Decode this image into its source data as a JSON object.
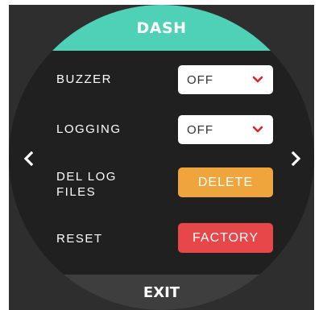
{
  "header": {
    "title": "DASH"
  },
  "footer": {
    "exit_label": "EXIT"
  },
  "nav": {
    "prev_glyph": "<",
    "next_glyph": ">"
  },
  "settings": {
    "buzzer": {
      "label": "BUZZER",
      "value": "OFF"
    },
    "logging": {
      "label": "LOGGING",
      "value": "OFF"
    },
    "del_log": {
      "label_line1": "DEL LOG",
      "label_line2": "FILES",
      "button": "DELETE"
    },
    "reset": {
      "label": "RESET",
      "button": "FACTORY"
    }
  },
  "icons": {
    "dropdown": "chevron-down-icon",
    "prev": "chevron-left-icon",
    "next": "chevron-right-icon"
  },
  "colors": {
    "header_bg": "#4fd1b8",
    "dial_bg": "#202020",
    "footer_bg": "#3e3e3e",
    "chevron": "#d8232a",
    "delete_btn": "#f0a53c",
    "factory_btn": "#e8474a",
    "text": "#ffffff"
  }
}
